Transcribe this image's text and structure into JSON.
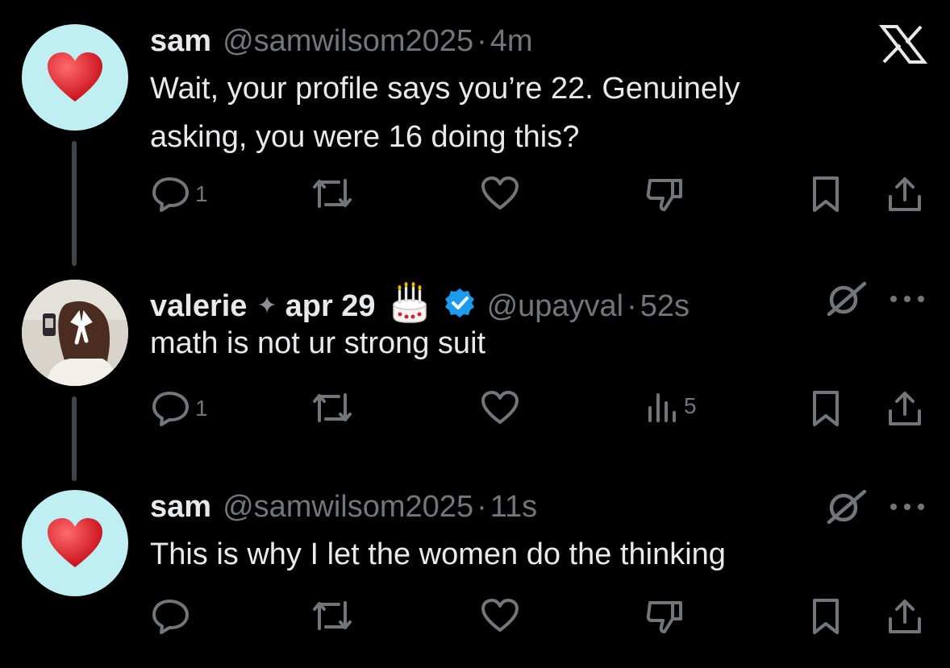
{
  "x_logo": "X",
  "tweets": [
    {
      "name": "sam",
      "handle": "@samwilsom2025",
      "dot": "·",
      "time": "4m",
      "text_lines": [
        "Wait, your profile says you’re 22. Genuinely",
        "asking, you were 16 doing this?"
      ],
      "reply_count": "1",
      "avatar_icon": "heart-icon"
    },
    {
      "name": "valerie",
      "name_suffix": "✦",
      "date_label": "apr 29",
      "handle": "@upayval",
      "dot": "·",
      "time": "52s",
      "text": "math is not ur strong suit",
      "reply_count": "1",
      "views_count": "5",
      "avatar_icon": "profile-photo"
    },
    {
      "name": "sam",
      "handle": "@samwilsom2025",
      "dot": "·",
      "time": "11s",
      "text": "This is why I let the women do the thinking",
      "avatar_icon": "heart-icon"
    }
  ],
  "colors": {
    "background": "#000000",
    "text": "#e7e9ea",
    "muted": "#71767b",
    "verified": "#1d9bf0",
    "heart": "#e0242e",
    "avatar_bg": "#bfeff3"
  }
}
